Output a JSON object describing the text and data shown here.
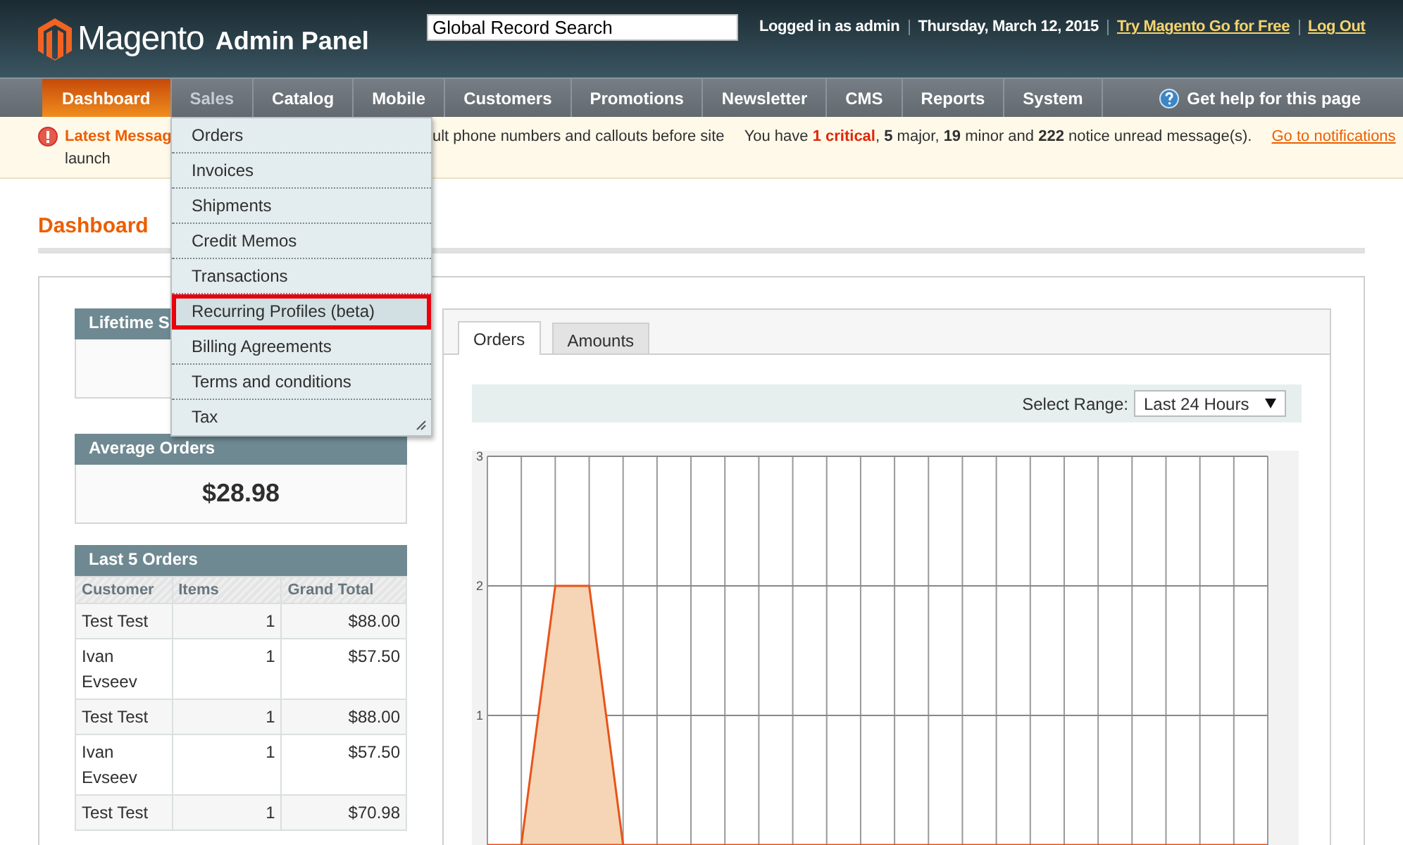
{
  "header": {
    "brand": "Magento",
    "brand_suffix": "Admin Panel",
    "search": {
      "value": "Global Record Search"
    },
    "user_text": "Logged in as admin",
    "date": "Thursday, March 12, 2015",
    "links": [
      "Try Magento Go for Free",
      "Log Out"
    ]
  },
  "nav": {
    "items": [
      {
        "label": "Dashboard",
        "selected": true,
        "expanded": false
      },
      {
        "label": "Sales",
        "selected": false,
        "expanded": true
      },
      {
        "label": "Catalog",
        "selected": false,
        "expanded": false
      },
      {
        "label": "Mobile",
        "selected": false,
        "expanded": false
      },
      {
        "label": "Customers",
        "selected": false,
        "expanded": false
      },
      {
        "label": "Promotions",
        "selected": false,
        "expanded": false
      },
      {
        "label": "Newsletter",
        "selected": false,
        "expanded": false
      },
      {
        "label": "CMS",
        "selected": false,
        "expanded": false
      },
      {
        "label": "Reports",
        "selected": false,
        "expanded": false
      },
      {
        "label": "System",
        "selected": false,
        "expanded": false
      }
    ],
    "help": "Get help for this page"
  },
  "sales_menu": [
    {
      "label": "Orders",
      "highlighted": false
    },
    {
      "label": "Invoices",
      "highlighted": false
    },
    {
      "label": "Shipments",
      "highlighted": false
    },
    {
      "label": "Credit Memos",
      "highlighted": false
    },
    {
      "label": "Transactions",
      "highlighted": false
    },
    {
      "label": "Recurring Profiles (beta)",
      "highlighted": true
    },
    {
      "label": "Billing Agreements",
      "highlighted": false
    },
    {
      "label": "Terms and conditions",
      "highlighted": false
    },
    {
      "label": "Tax",
      "highlighted": false
    }
  ],
  "notice": {
    "title": "Latest Messag",
    "text_line1": "ult phone numbers and callouts before site",
    "text_line2": "launch",
    "summary": "You have **1 critical**, **5** major, **19** minor and **222** notice unread message(s).",
    "link": "Go to notifications"
  },
  "page_title": "Dashboard",
  "lifetime_sales": {
    "title": "Lifetime S"
  },
  "average_orders": {
    "title": "Average Orders",
    "value": "$28.98"
  },
  "last_orders": {
    "title": "Last 5 Orders",
    "columns": [
      "Customer",
      "Items",
      "Grand Total"
    ],
    "rows": [
      [
        "Test Test",
        "1",
        "$88.00"
      ],
      [
        "Ivan Evseev",
        "1",
        "$57.50"
      ],
      [
        "Test Test",
        "1",
        "$88.00"
      ],
      [
        "Ivan Evseev",
        "1",
        "$57.50"
      ],
      [
        "Test Test",
        "1",
        "$70.98"
      ]
    ]
  },
  "chart_panel": {
    "tabs": [
      {
        "label": "Orders",
        "selected": true
      },
      {
        "label": "Amounts",
        "selected": false
      }
    ],
    "range_label": "Select Range:",
    "range_value": "Last 24 Hours",
    "chart_data": {
      "type": "area",
      "grid": true,
      "ylim": [
        0,
        3
      ],
      "yticks": [
        1,
        2,
        3
      ],
      "series": [
        {
          "color": "#e8531a",
          "values": [
            0,
            0,
            2,
            2,
            0,
            0,
            0,
            0,
            0,
            0,
            0,
            0,
            0,
            0,
            0,
            0,
            0,
            0,
            0,
            0,
            0,
            0,
            0,
            0
          ]
        }
      ]
    }
  }
}
